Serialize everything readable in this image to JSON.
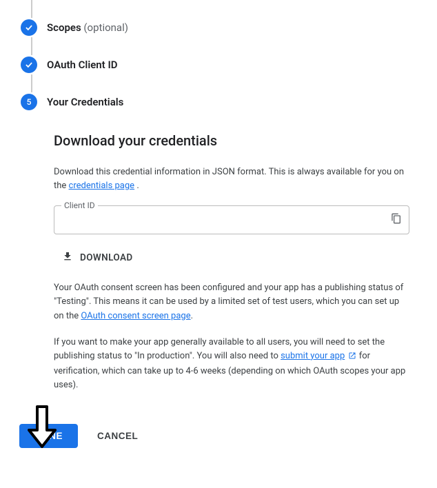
{
  "steps": {
    "scopes": {
      "label": "Scopes",
      "suffix": "(optional)"
    },
    "oauth_client_id": {
      "label": "OAuth Client ID"
    },
    "your_credentials": {
      "number": "5",
      "label": "Your Credentials"
    }
  },
  "section": {
    "title": "Download your credentials",
    "intro_pre": "Download this credential information in JSON format. This is always available for you on the ",
    "intro_link": "credentials page",
    "intro_post": " .",
    "client_id_label": "Client ID",
    "client_id_value": "",
    "download_label": "DOWNLOAD",
    "consent_pre": "Your OAuth consent screen has been configured and your app has a publishing status of \"Testing\". This means it can be used by a limited set of test users, which you can set up on the ",
    "consent_link": "OAuth consent screen page",
    "consent_post": ".",
    "prod_pre": "If you want to make your app generally available to all users, you will need to set the publishing status to \"In production\". You will also need to ",
    "prod_link": "submit your app",
    "prod_post": " for verification, which can take up to 4-6 weeks (depending on which OAuth scopes your app uses)."
  },
  "actions": {
    "done": "DONE",
    "cancel": "CANCEL"
  }
}
